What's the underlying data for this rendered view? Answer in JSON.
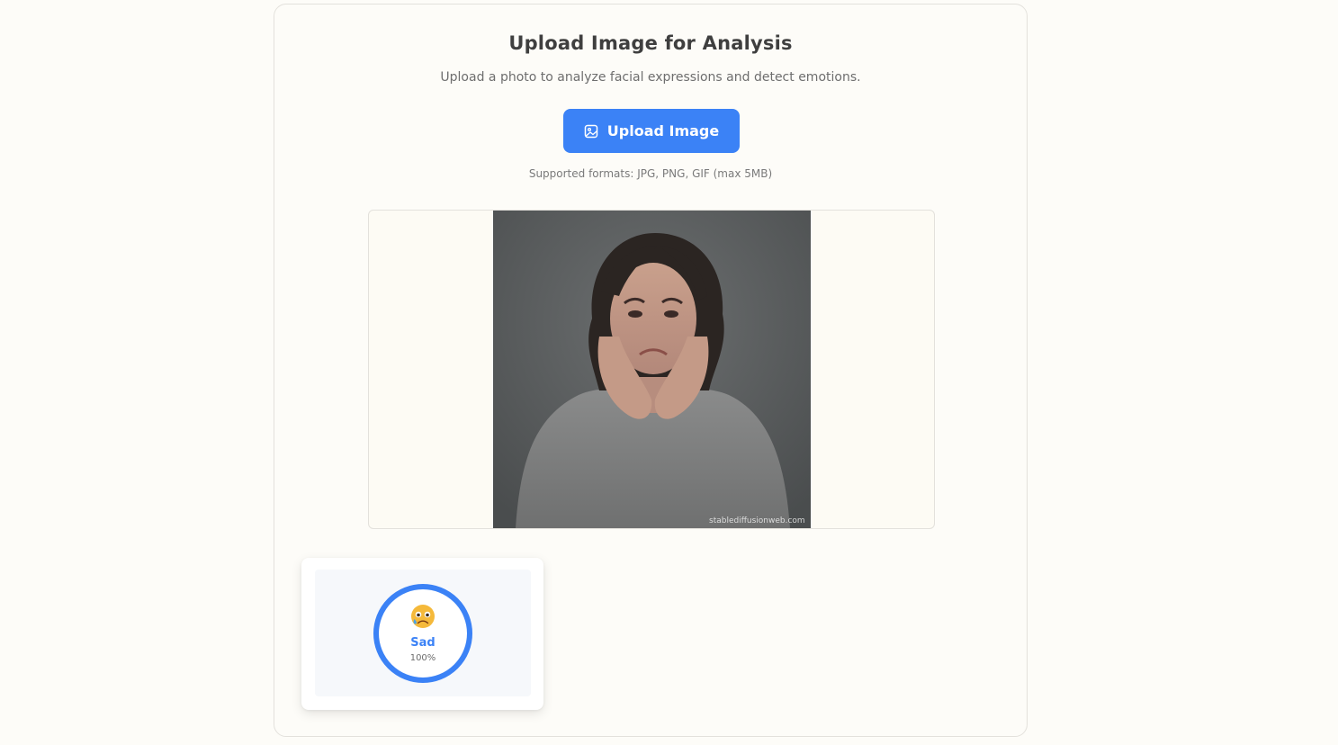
{
  "header": {
    "title": "Upload Image for Analysis",
    "subtitle": "Upload a photo to analyze facial expressions and detect emotions."
  },
  "upload": {
    "button_label": "Upload Image",
    "button_icon": "image-icon",
    "formats_note": "Supported formats: JPG, PNG, GIF (max 5MB)"
  },
  "preview": {
    "watermark": "stablediffusionweb.com"
  },
  "result": {
    "emoji_icon": "sad-face-icon",
    "emotion": "Sad",
    "confidence_label": "100%",
    "confidence": 1.0
  },
  "colors": {
    "accent": "#3b82f6",
    "background": "#fdfcf8"
  }
}
